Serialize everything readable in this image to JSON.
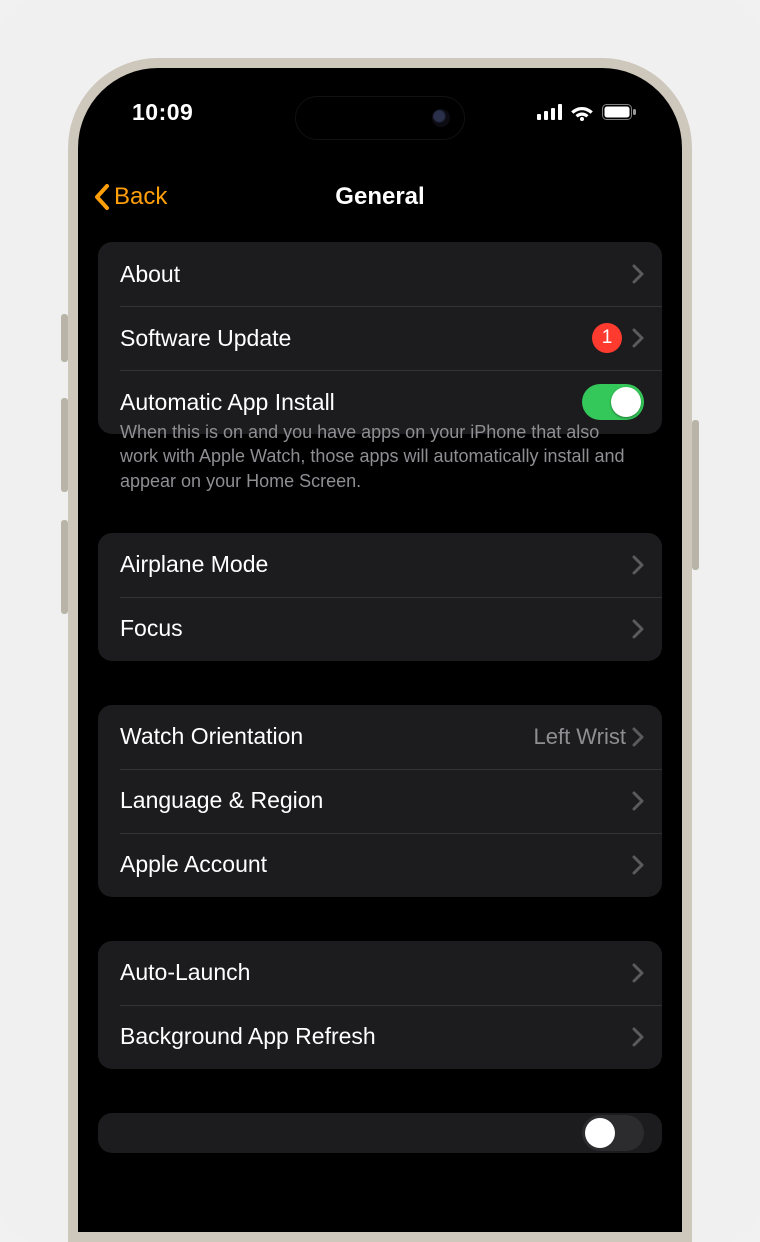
{
  "status": {
    "time": "10:09"
  },
  "nav": {
    "back": "Back",
    "title": "General"
  },
  "group1": {
    "about": "About",
    "softwareUpdate": "Software Update",
    "softwareUpdateBadge": "1",
    "autoInstall": "Automatic App Install",
    "autoInstallOn": true,
    "footer": "When this is on and you have apps on your iPhone that also work with Apple Watch, those apps will automatically install and appear on your Home Screen."
  },
  "group2": {
    "airplane": "Airplane Mode",
    "focus": "Focus"
  },
  "group3": {
    "orientation": "Watch Orientation",
    "orientationValue": "Left Wrist",
    "language": "Language & Region",
    "account": "Apple Account"
  },
  "group4": {
    "autoLaunch": "Auto-Launch",
    "bgRefresh": "Background App Refresh"
  }
}
